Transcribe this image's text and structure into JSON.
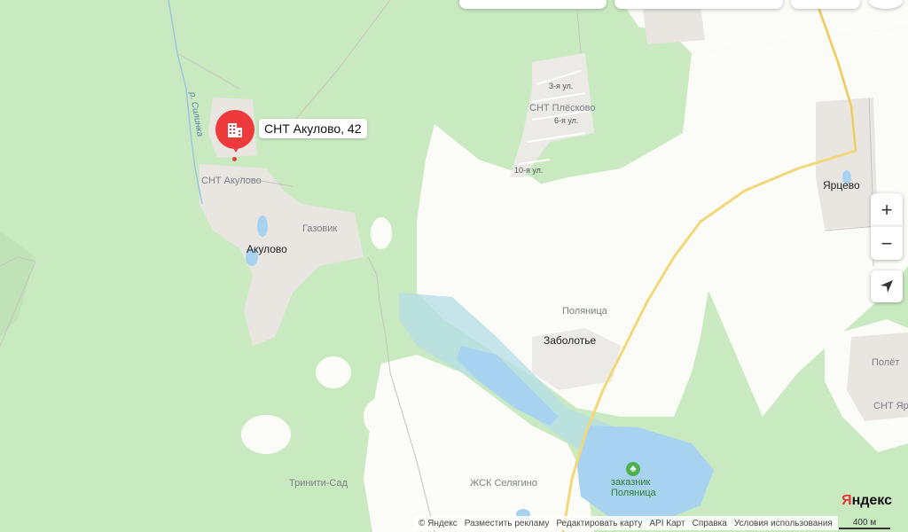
{
  "map": {
    "colors": {
      "forest": "#c9eac1",
      "field": "#fbfcf7",
      "water": "#a8d3f0",
      "settlement": "#e9e6e2",
      "road": "#f3d87a",
      "accent": "#ee3a3a"
    },
    "marker": {
      "label": "СНТ Акулово, 42",
      "icon": "building-icon"
    },
    "labels": {
      "river": "р. Силинка",
      "snt_akulovo": "СНТ Акулово",
      "gazovik": "Газовик",
      "akulovo": "Акулово",
      "street3": "3-я ул.",
      "snt_pleskovo": "СНТ Плёсково",
      "street6": "6-я ул.",
      "street10": "10-я ул.",
      "yartsevo": "Ярцево",
      "polyanitsa": "Поляница",
      "zabolotye": "Заболотье",
      "polet": "Полёт",
      "snt_yartsevo": "СНТ Ярцево",
      "triniti": "Тринити-Сад",
      "zhsk": "ЖСК Селягино",
      "reserve_1": "заказник",
      "reserve_2": "Поляница"
    },
    "reserve_icon": "tree-icon",
    "controls": {
      "zoom_in": "+",
      "zoom_out": "−",
      "locate_icon": "navigation-arrow-icon"
    },
    "footer": {
      "copyright": "© Яндекс",
      "links": [
        "Разместить рекламу",
        "Редактировать карту",
        "API Карт",
        "Справка",
        "Условия использования"
      ]
    },
    "brand": {
      "first": "Я",
      "rest": "ндекс"
    },
    "scale": "400 м"
  }
}
